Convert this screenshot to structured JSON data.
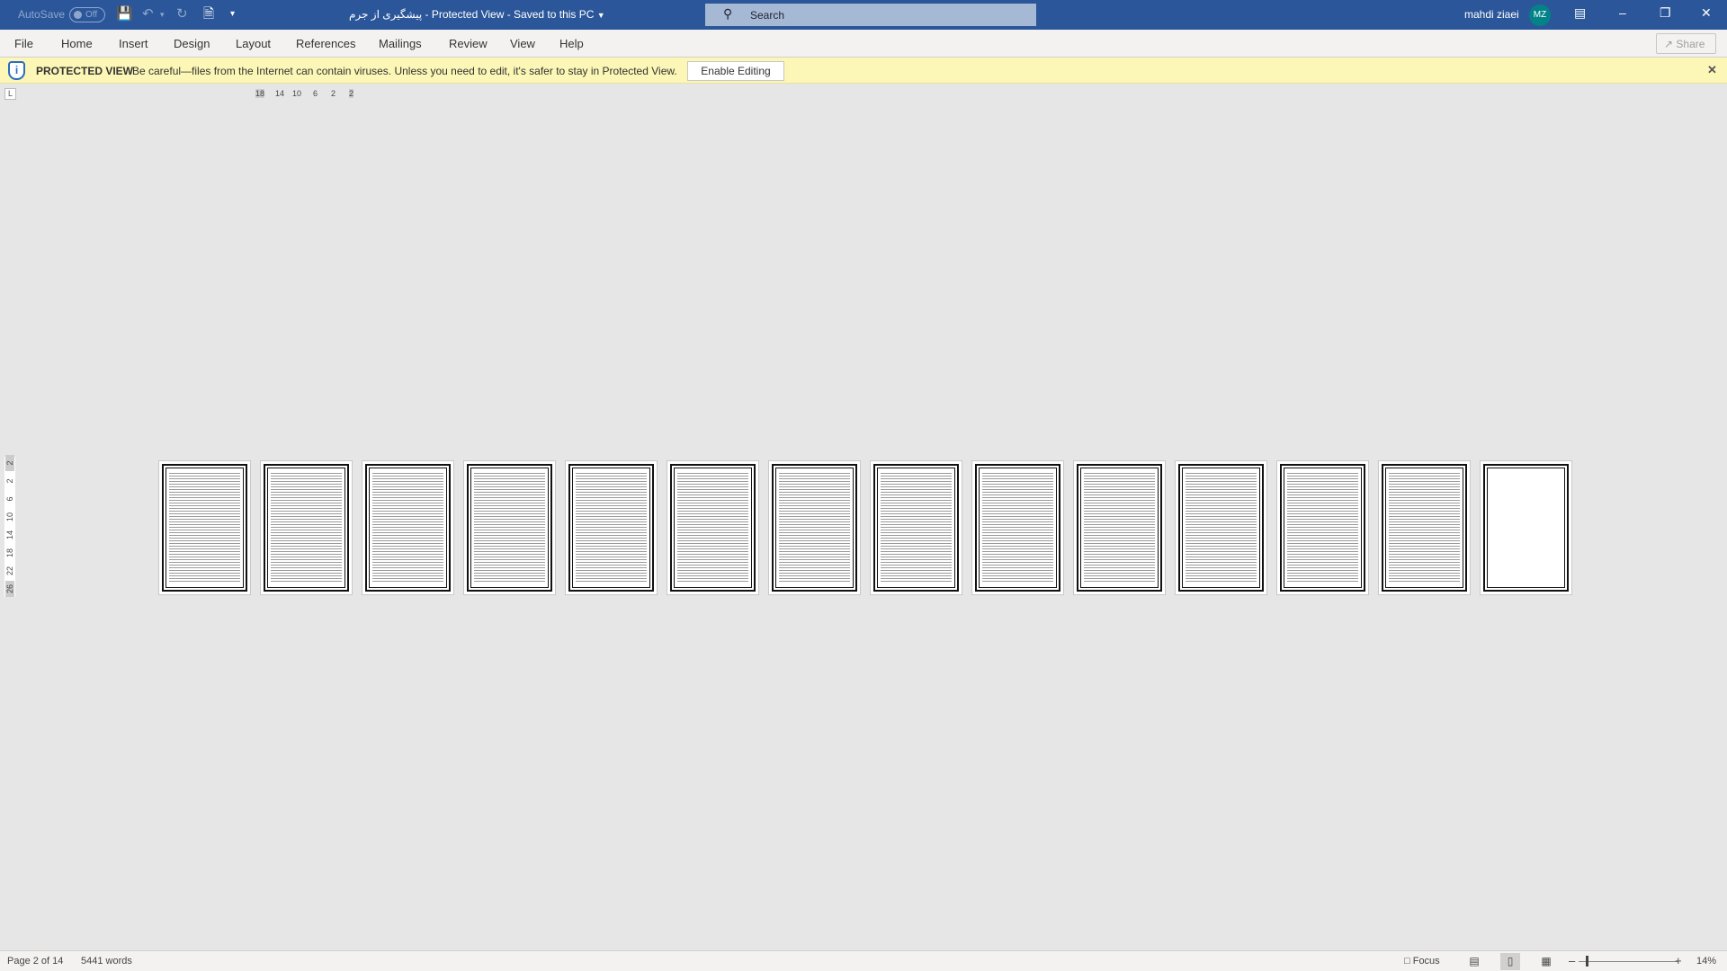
{
  "titlebar": {
    "autosave_label": "AutoSave",
    "autosave_state": "Off",
    "document_title": "پیشگیری از جرم",
    "mode": "Protected View",
    "save_status": "Saved to this PC",
    "search_placeholder": "Search",
    "user_name": "mahdi ziaei",
    "user_initials": "MZ",
    "avatar_color": "#038387",
    "accent_color": "#2b579a"
  },
  "ribbon": {
    "tabs": [
      "File",
      "Home",
      "Insert",
      "Design",
      "Layout",
      "References",
      "Mailings",
      "Review",
      "View",
      "Help"
    ],
    "share_label": "Share"
  },
  "protected_bar": {
    "label": "PROTECTED VIEW",
    "message": "Be careful—files from the Internet can contain viruses. Unless you need to edit, it's safer to stay in Protected View.",
    "button": "Enable Editing",
    "background": "#fcf7b6"
  },
  "ruler": {
    "tab_stop": "L",
    "horizontal": [
      "18",
      "14",
      "10",
      "6",
      "2",
      "2"
    ],
    "vertical": [
      "2",
      "2",
      "6",
      "10",
      "14",
      "18",
      "22",
      "26"
    ]
  },
  "document": {
    "page_count": 14
  },
  "status": {
    "page": "Page 2 of 14",
    "words": "5441 words",
    "focus": "Focus",
    "zoom": "14%",
    "zoom_percent": 14
  }
}
